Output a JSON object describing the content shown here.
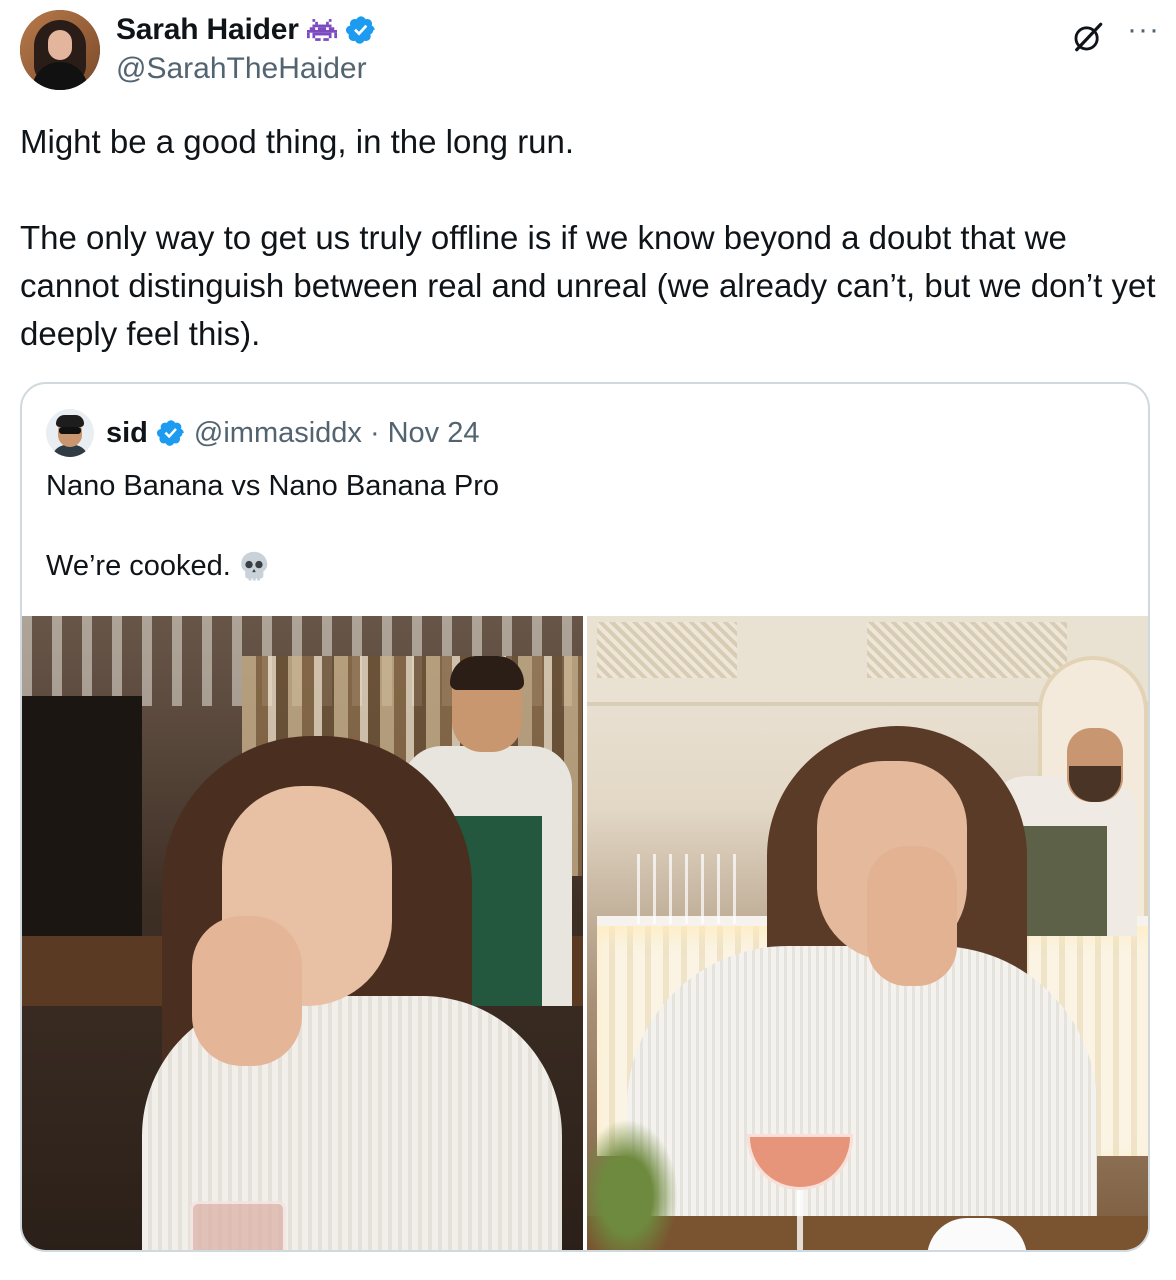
{
  "post": {
    "author": {
      "display_name": "Sarah Haider",
      "handle": "@SarahTheHaider",
      "badge_emoji": "space-invader-emoji",
      "verified": true
    },
    "text": "Might be a good thing, in the long run.\n\nThe only way to get us truly offline is if we know beyond a doubt that we cannot distinguish between real and unreal (we already can’t, but we don’t yet deeply feel this).",
    "actions": {
      "grok_icon": "grok-icon",
      "more_label": "···"
    }
  },
  "quote": {
    "author": {
      "display_name": "sid",
      "handle": "@immasiddx",
      "separator": "·",
      "date": "Nov 24",
      "verified": true
    },
    "text": "Nano Banana vs Nano Banana Pro\n\nWe’re cooked.",
    "text_emoji": "skull-emoji",
    "media": [
      {
        "description_name": "photo-nano-banana",
        "icon": "image"
      },
      {
        "description_name": "photo-nano-banana-pro",
        "icon": "image"
      }
    ]
  },
  "colors": {
    "text_primary": "#0f1419",
    "text_secondary": "#536471",
    "verified_blue": "#1d9bf0",
    "border": "#cfd9de"
  }
}
